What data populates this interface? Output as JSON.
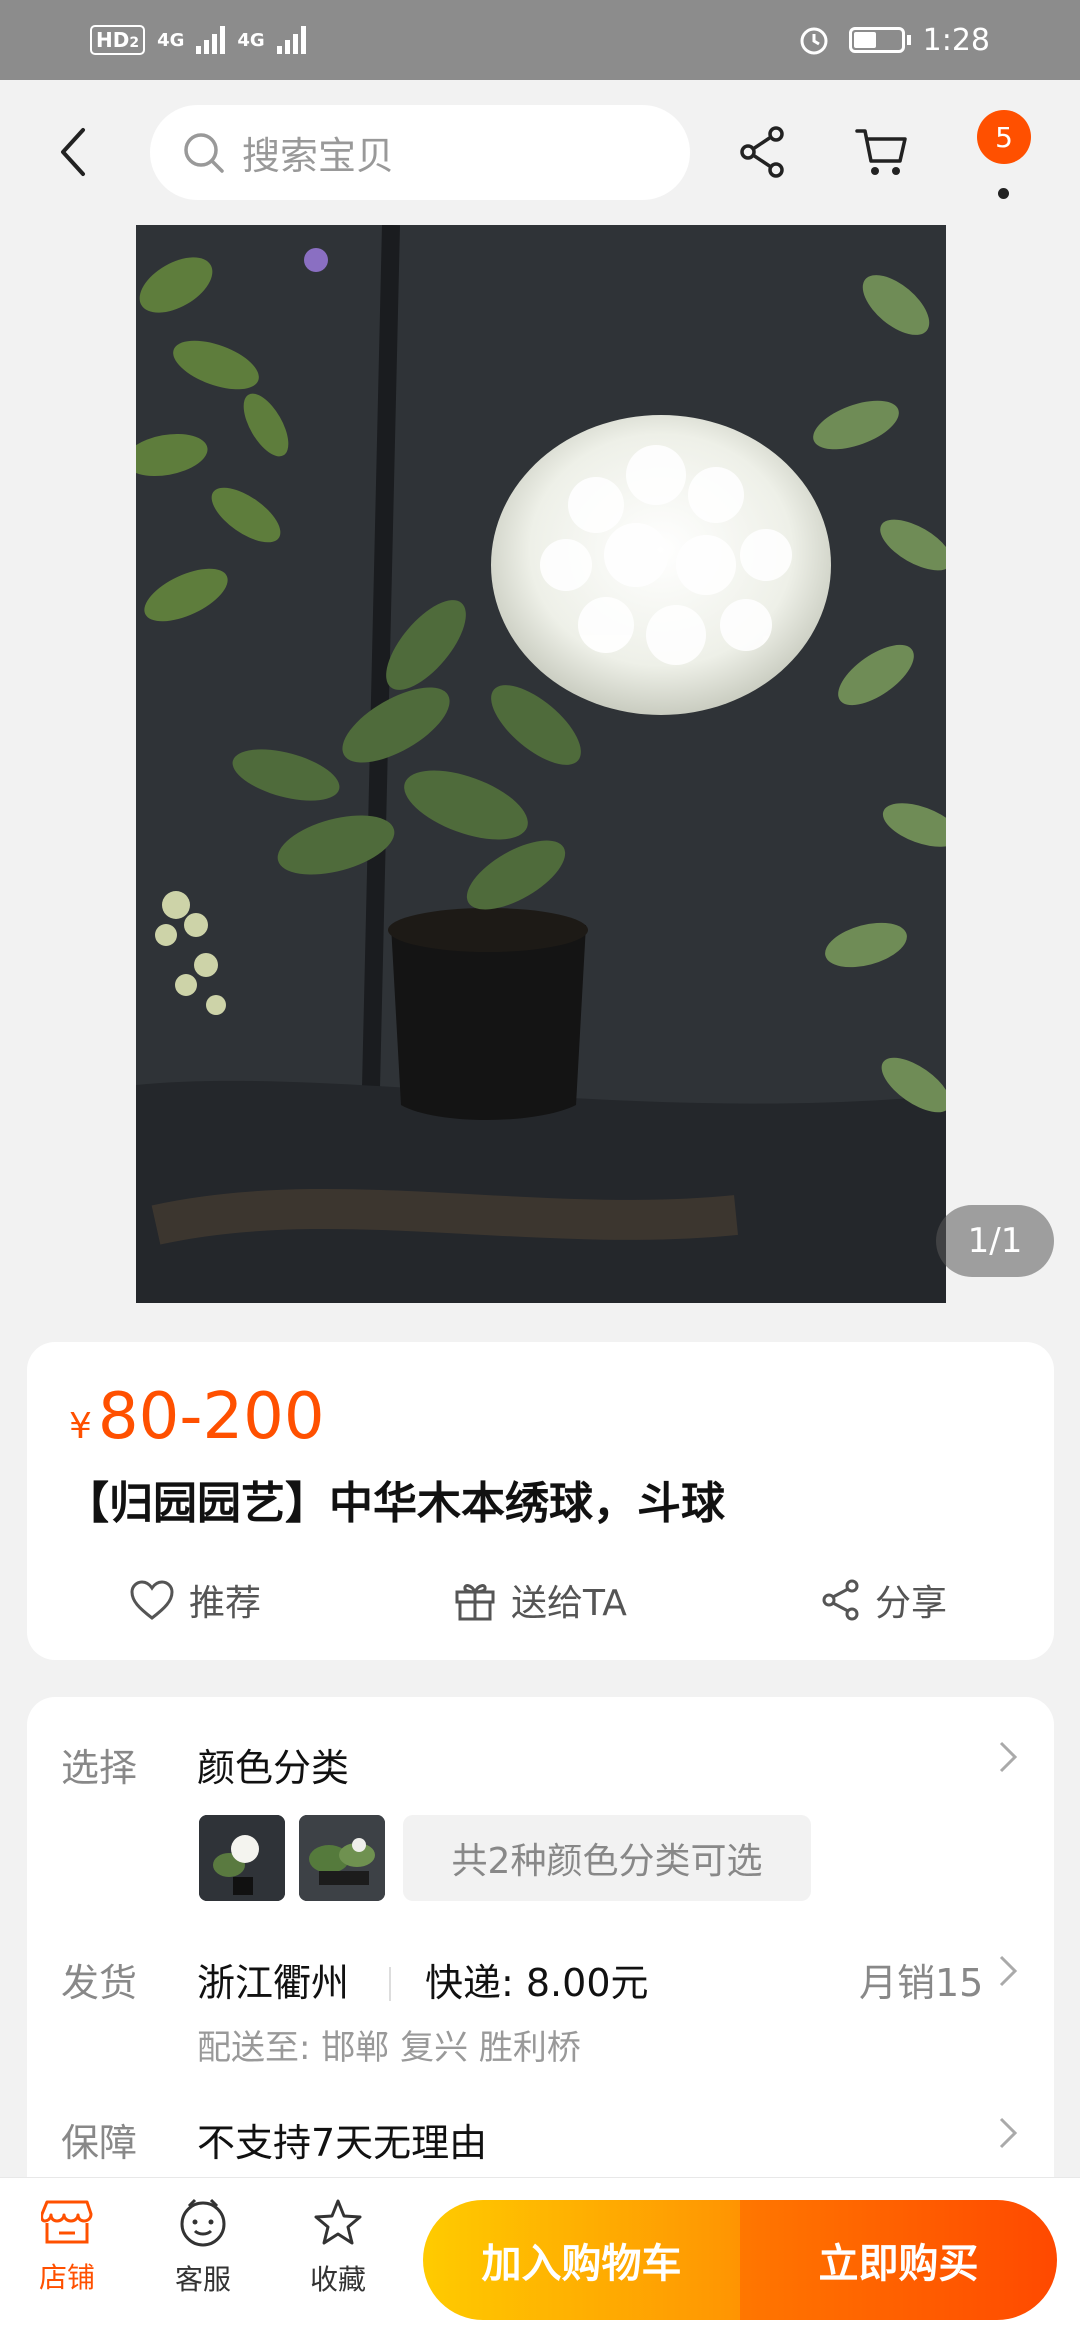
{
  "status_bar": {
    "hd_label": "HD",
    "hd_sub": "2",
    "signal1": "4G",
    "signal2": "4G",
    "time": "1:28",
    "icons": [
      "alarm-icon",
      "battery-icon"
    ]
  },
  "header": {
    "search_placeholder": "搜索宝贝",
    "cart_badge": "5",
    "icons": [
      "back-icon",
      "search-icon",
      "share-icon",
      "cart-icon",
      "more-icon"
    ]
  },
  "gallery": {
    "counter": "1/1"
  },
  "product": {
    "currency": "¥",
    "price": "80-200",
    "title": "【归园园艺】中华木本绣球，斗球",
    "actions": [
      {
        "label": "推荐",
        "icon": "heart-icon"
      },
      {
        "label": "送给TA",
        "icon": "gift-icon"
      },
      {
        "label": "分享",
        "icon": "share-icon"
      }
    ]
  },
  "details": {
    "select": {
      "label": "选择",
      "value": "颜色分类",
      "options_note": "共2种颜色分类可选"
    },
    "shipping": {
      "label": "发货",
      "origin": "浙江衢州",
      "fee": "快递: 8.00元",
      "monthly_sales": "月销15",
      "deliver_to": "配送至: 邯郸 复兴 胜利桥"
    },
    "guarantee": {
      "label": "保障",
      "value": "不支持7天无理由"
    }
  },
  "bottom_bar": {
    "shop": "店铺",
    "service": "客服",
    "favorite": "收藏",
    "add_to_cart": "加入购物车",
    "buy_now": "立即购买"
  },
  "colors": {
    "accent": "#ff5000",
    "cart_gradient": [
      "#ffcb00",
      "#ff9402"
    ],
    "buy_gradient": [
      "#ff7700",
      "#ff4900"
    ]
  }
}
